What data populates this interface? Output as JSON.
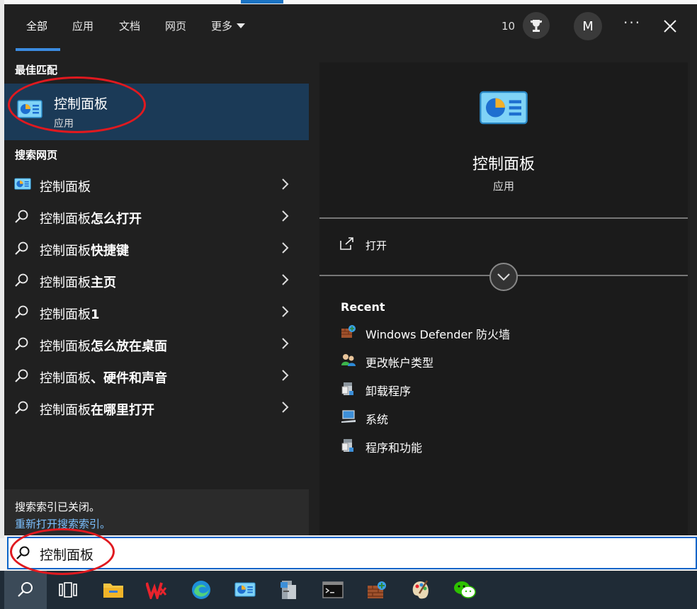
{
  "tabs": [
    {
      "label": "全部",
      "active": true
    },
    {
      "label": "应用"
    },
    {
      "label": "文档"
    },
    {
      "label": "网页"
    },
    {
      "label": "更多"
    }
  ],
  "header": {
    "points": "10",
    "avatar_initial": "M",
    "more_options": "···"
  },
  "best_match": {
    "heading": "最佳匹配",
    "title": "控制面板",
    "type": "应用"
  },
  "web_search": {
    "heading": "搜索网页",
    "items": [
      {
        "prefix": "控制面板",
        "suffix": "",
        "icon": "control-panel-icon"
      },
      {
        "prefix": "控制面板",
        "suffix": "怎么打开",
        "icon": "search-icon"
      },
      {
        "prefix": "控制面板",
        "suffix": "快捷键",
        "icon": "search-icon"
      },
      {
        "prefix": "控制面板",
        "suffix": "主页",
        "icon": "search-icon"
      },
      {
        "prefix": "控制面板",
        "suffix": "1",
        "icon": "search-icon"
      },
      {
        "prefix": "控制面板",
        "suffix": "怎么放在桌面",
        "icon": "search-icon"
      },
      {
        "prefix": "控制面板",
        "suffix": "、硬件和声音",
        "icon": "search-icon"
      },
      {
        "prefix": "控制面板",
        "suffix": "在哪里打开",
        "icon": "search-icon"
      }
    ]
  },
  "index_status": {
    "message": "搜索索引已关闭。",
    "link": "重新打开搜索索引。"
  },
  "preview": {
    "title": "控制面板",
    "type": "应用",
    "open_label": "打开",
    "recent_heading": "Recent",
    "recent": [
      {
        "label": "Windows Defender 防火墙",
        "icon": "firewall-icon"
      },
      {
        "label": "更改帐户类型",
        "icon": "user-accounts-icon"
      },
      {
        "label": "卸载程序",
        "icon": "programs-icon"
      },
      {
        "label": "系统",
        "icon": "system-icon"
      },
      {
        "label": "程序和功能",
        "icon": "programs-icon"
      }
    ]
  },
  "search": {
    "value": "控制面板"
  },
  "taskbar": [
    {
      "name": "search-icon"
    },
    {
      "name": "task-view-icon"
    },
    {
      "name": "file-explorer-icon"
    },
    {
      "name": "wps-office-icon"
    },
    {
      "name": "edge-browser-icon"
    },
    {
      "name": "control-panel-icon"
    },
    {
      "name": "server-manager-icon"
    },
    {
      "name": "terminal-icon"
    },
    {
      "name": "firewall-icon"
    },
    {
      "name": "paint-icon"
    },
    {
      "name": "wechat-icon"
    }
  ],
  "colors": {
    "panel_bg": "#202020",
    "accent": "#3b8be0",
    "highlight": "#1b3a57",
    "annotation": "#e0191f"
  }
}
